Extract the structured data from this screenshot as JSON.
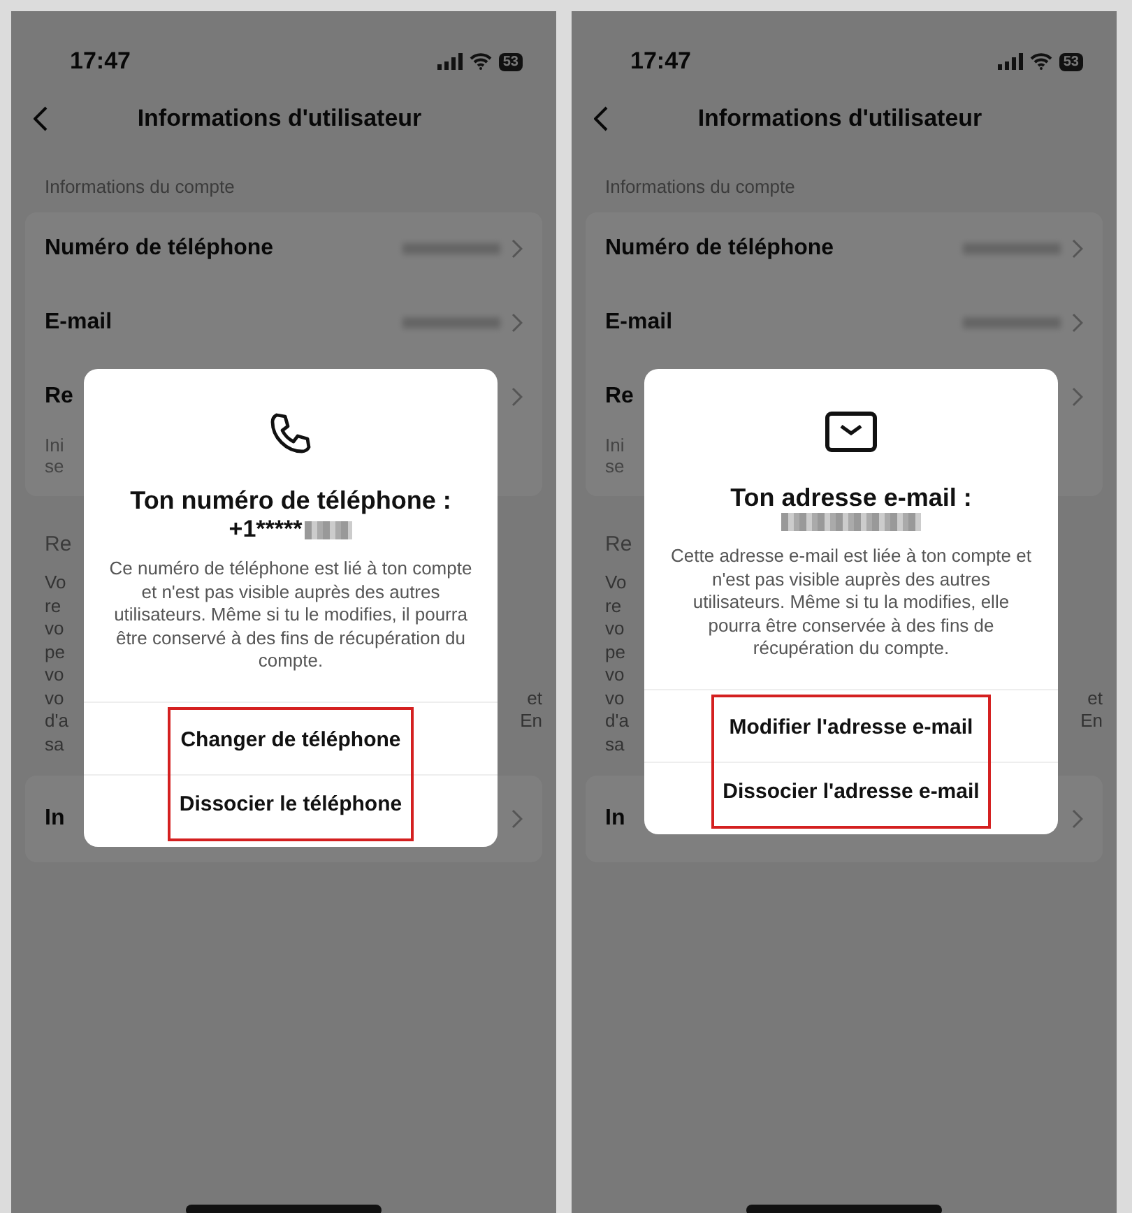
{
  "screens": [
    {
      "status_bar": {
        "time": "17:47",
        "battery": "53"
      },
      "nav": {
        "title": "Informations d'utilisateur"
      },
      "section_label": "Informations du compte",
      "account_rows": [
        {
          "label": "Numéro de téléphone",
          "redacted": true
        },
        {
          "label": "E-mail",
          "redacted": true
        },
        {
          "label": "Re",
          "redacted": false
        }
      ],
      "row_note_fragments": [
        "Ini",
        "se"
      ],
      "section2_label": "Re",
      "paragraph_lines": [
        {
          "left": "Vo"
        },
        {
          "left": "re"
        },
        {
          "left": "vo"
        },
        {
          "left": "pe"
        },
        {
          "left": "vo"
        },
        {
          "left": "vo",
          "right": "et"
        },
        {
          "left": "d'a",
          "right": "En"
        },
        {
          "left": "sa"
        }
      ],
      "last_row": "In",
      "dialog": {
        "kind": "phone",
        "title": "Ton numéro de téléphone :",
        "value": "+1*****",
        "value_redacted": true,
        "body": "Ce numéro de téléphone est lié à ton compte et n'est pas visible auprès des autres utilisateurs. Même si tu le modifies, il pourra être conservé à des fins de récupération du compte.",
        "actions": [
          "Changer de téléphone",
          "Dissocier le téléphone"
        ],
        "highlighted": true
      }
    },
    {
      "status_bar": {
        "time": "17:47",
        "battery": "53"
      },
      "nav": {
        "title": "Informations d'utilisateur"
      },
      "section_label": "Informations du compte",
      "account_rows": [
        {
          "label": "Numéro de téléphone",
          "redacted": true
        },
        {
          "label": "E-mail",
          "redacted": true
        },
        {
          "label": "Re",
          "redacted": false
        }
      ],
      "row_note_fragments": [
        "Ini",
        "se"
      ],
      "section2_label": "Re",
      "paragraph_lines": [
        {
          "left": "Vo"
        },
        {
          "left": "re"
        },
        {
          "left": "vo"
        },
        {
          "left": "pe"
        },
        {
          "left": "vo"
        },
        {
          "left": "vo",
          "right": "et"
        },
        {
          "left": "d'a",
          "right": "En"
        },
        {
          "left": "sa"
        }
      ],
      "last_row": "In",
      "dialog": {
        "kind": "email",
        "title": "Ton adresse e-mail :",
        "value_redacted": true,
        "body": "Cette adresse e-mail est liée à ton compte et n'est pas visible auprès des autres utilisateurs. Même si tu la modifies, elle pourra être conservée à des fins de récupération du compte.",
        "actions": [
          "Modifier l'adresse e-mail",
          "Dissocier l'adresse e-mail"
        ],
        "highlighted": true
      }
    }
  ]
}
